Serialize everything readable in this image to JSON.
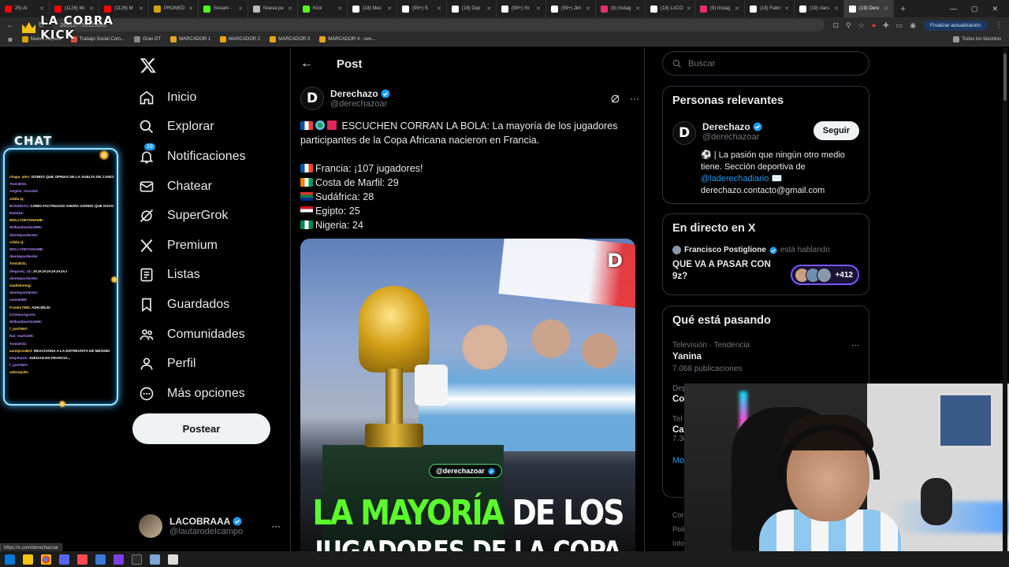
{
  "browser": {
    "tabs": [
      {
        "label": "25) Al",
        "color": "#ff0000"
      },
      {
        "label": "(1126) Mi",
        "color": "#ff0000"
      },
      {
        "label": "(1126) M",
        "color": "#ff0000"
      },
      {
        "label": "PROMED",
        "color": "#d8a000"
      },
      {
        "label": "Stream - ",
        "color": "#53fc18"
      },
      {
        "label": "Nueva pe",
        "color": "#bbbbbb"
      },
      {
        "label": "Kick",
        "color": "#53fc18"
      },
      {
        "label": "(18) Mes",
        "color": "#ffffff"
      },
      {
        "label": "(99+) S",
        "color": "#ffffff"
      },
      {
        "label": "(18) Dep",
        "color": "#ffffff"
      },
      {
        "label": "(99+) Yo",
        "color": "#ffffff"
      },
      {
        "label": "(99+) Jim",
        "color": "#ffffff"
      },
      {
        "label": "(9) Instag",
        "color": "#e1306c"
      },
      {
        "label": "(18) LACO",
        "color": "#ffffff"
      },
      {
        "label": "(9) Instag",
        "color": "#e1306c"
      },
      {
        "label": "(18) Fabri",
        "color": "#ffffff"
      },
      {
        "label": "(19) clars",
        "color": "#ffffff"
      },
      {
        "label": "(19) Dere",
        "color": "#ffffff",
        "active": true
      }
    ],
    "new_tab": "+",
    "url": "265137753325616",
    "update_button": "Finalizar actualización",
    "bookmarks": [
      {
        "label": "Nueva carpeta",
        "color": "#d8a000"
      },
      {
        "label": "Trabajo Social Com...",
        "color": "#e84d3d"
      },
      {
        "label": "Gran DT",
        "color": "#888888"
      },
      {
        "label": "MARCADOR 1",
        "color": "#e8a317"
      },
      {
        "label": "MARCADOR 2",
        "color": "#e8a317"
      },
      {
        "label": "MARCADOR 3",
        "color": "#e8a317"
      },
      {
        "label": "MARCADOR 4 - ove...",
        "color": "#e8a317"
      }
    ],
    "all_bookmarks": "Todos los favoritos",
    "status_url": "https://x.com/derechazoar"
  },
  "overlay": {
    "logo_text": "LA COBRA KICK",
    "chat_title": "CHAT",
    "chat_lines": [
      {
        "user": "chapa_alex",
        "msg": ": GORDO QUE OPINAS DE LA VUELTA DE CANCELO"
      },
      {
        "user": "Tomi3031",
        "msg": ":"
      },
      {
        "user": "Angelo_ms1243",
        "msg": ":"
      },
      {
        "user": "viddu.sj",
        "msg": ":"
      },
      {
        "user": "BOODDAA",
        "msg": ": COMO FACTRUASS AHORA GORDO QUE DAVOO ESTA DE VACACIONES"
      },
      {
        "user": "Rami24",
        "msg": ":"
      },
      {
        "user": "MOLLYDETONAME",
        "msg": ":"
      },
      {
        "user": "Williambenitez999",
        "msg": ":"
      },
      {
        "user": "dientepordiente",
        "msg": ":"
      },
      {
        "user": "viddu.sj",
        "msg": ":"
      },
      {
        "user": "MOLLYDETONAME",
        "msg": ":"
      },
      {
        "user": "dientepordiente",
        "msg": ":"
      },
      {
        "user": "Tomi3031",
        "msg": ":"
      },
      {
        "user": "diegooej_23",
        "msg": ": JAJAJAJAJAJAJAJ"
      },
      {
        "user": "dientepordiente",
        "msg": ":"
      },
      {
        "user": "Gadielomng",
        "msg": ":"
      },
      {
        "user": "dientepordiente",
        "msg": ":"
      },
      {
        "user": "samat069",
        "msg": ":"
      },
      {
        "user": "Franko7080",
        "msg": ": ADN MILEI"
      },
      {
        "user": "CristianAgurto",
        "msg": ":"
      },
      {
        "user": "Williambenitez999",
        "msg": ":"
      },
      {
        "user": "f_joel7997",
        "msg": ":"
      },
      {
        "user": "Nat_martin09",
        "msg": ":"
      },
      {
        "user": "Tomi3031",
        "msg": ":"
      },
      {
        "user": "santiprosBol",
        "msg": ": REACCIONA A LA ENTREVISTA DE MESSIIII"
      },
      {
        "user": "Elephant1",
        "msg": ": JUEGAN EN FRANCIA..."
      },
      {
        "user": "f_joel7997",
        "msg": ":"
      },
      {
        "user": "sabonjudo",
        "msg": ":"
      }
    ]
  },
  "left_nav": {
    "items": [
      {
        "label": "Inicio",
        "icon": "home-icon"
      },
      {
        "label": "Explorar",
        "icon": "search-icon"
      },
      {
        "label": "Notificaciones",
        "icon": "bell-icon",
        "badge": "19"
      },
      {
        "label": "Chatear",
        "icon": "mail-icon"
      },
      {
        "label": "SuperGrok",
        "icon": "grok-icon"
      },
      {
        "label": "Premium",
        "icon": "x-icon"
      },
      {
        "label": "Listas",
        "icon": "list-icon"
      },
      {
        "label": "Guardados",
        "icon": "bookmark-icon"
      },
      {
        "label": "Comunidades",
        "icon": "communities-icon"
      },
      {
        "label": "Perfil",
        "icon": "person-icon"
      },
      {
        "label": "Más opciones",
        "icon": "more-circle-icon"
      }
    ],
    "post_button": "Postear",
    "me": {
      "name": "LACOBRAAA",
      "handle": "@lautarodeIcampo",
      "more": "···"
    }
  },
  "post": {
    "header_title": "Post",
    "author": {
      "name": "Derechazo",
      "handle": "@derechazoar",
      "avatar_letter": "D"
    },
    "text_intro": "ESCUCHEN CORRAN LA BOLA: La mayoría de los jugadores participantes de la Copa Africana nacieron en Francia.",
    "stats": [
      {
        "flag": "france",
        "text": "Francia: ¡107 jugadores!"
      },
      {
        "flag": "ivory-coast",
        "text": "Costa de Marfil: 29"
      },
      {
        "flag": "south-africa",
        "text": "Sudáfrica: 28"
      },
      {
        "flag": "egypt",
        "text": "Egipto: 25"
      },
      {
        "flag": "nigeria",
        "text": "Nigeria: 24"
      }
    ],
    "media": {
      "brand_letter": "D",
      "handle_tag": "@derechazoar",
      "caption_green": "LA MAYORÍA",
      "caption_white": " DE LOS",
      "caption_line2": "JUGADORES DE LA COPA"
    }
  },
  "right": {
    "search_placeholder": "Buscar",
    "relevant": {
      "title": "Personas relevantes",
      "name": "Derechazo",
      "handle": "@derechazoar",
      "follow": "Seguir",
      "bio_1": "⚽ | La pasión que ningún otro medio tiene. Sección deportiva de ",
      "bio_link": "@laderechadiario",
      "bio_2": " ✉️ derechazo.contacto@gmail.com"
    },
    "live": {
      "title": "En directo en X",
      "host": "Francisco Postiglione",
      "status": "está hablando",
      "space_title": "QUE VA A PASAR CON 9z?",
      "listeners": "+412"
    },
    "trending": {
      "title": "Qué está pasando",
      "category": "Televisión · Tendencia",
      "name": "Yanina",
      "count": "7.068 publicaciones",
      "cut_1_meta": "Dep",
      "cut_1_name": "Co",
      "cut_2_meta": "Tel",
      "cut_2_name": "Ca",
      "cut_2_count": "7.30",
      "show_more": "Mo"
    },
    "footer": [
      "Con",
      "Polí",
      "Info"
    ]
  },
  "colors": {
    "accent": "#1d9bf0",
    "verified": "#1d9bf0",
    "live": "#7856ff"
  }
}
